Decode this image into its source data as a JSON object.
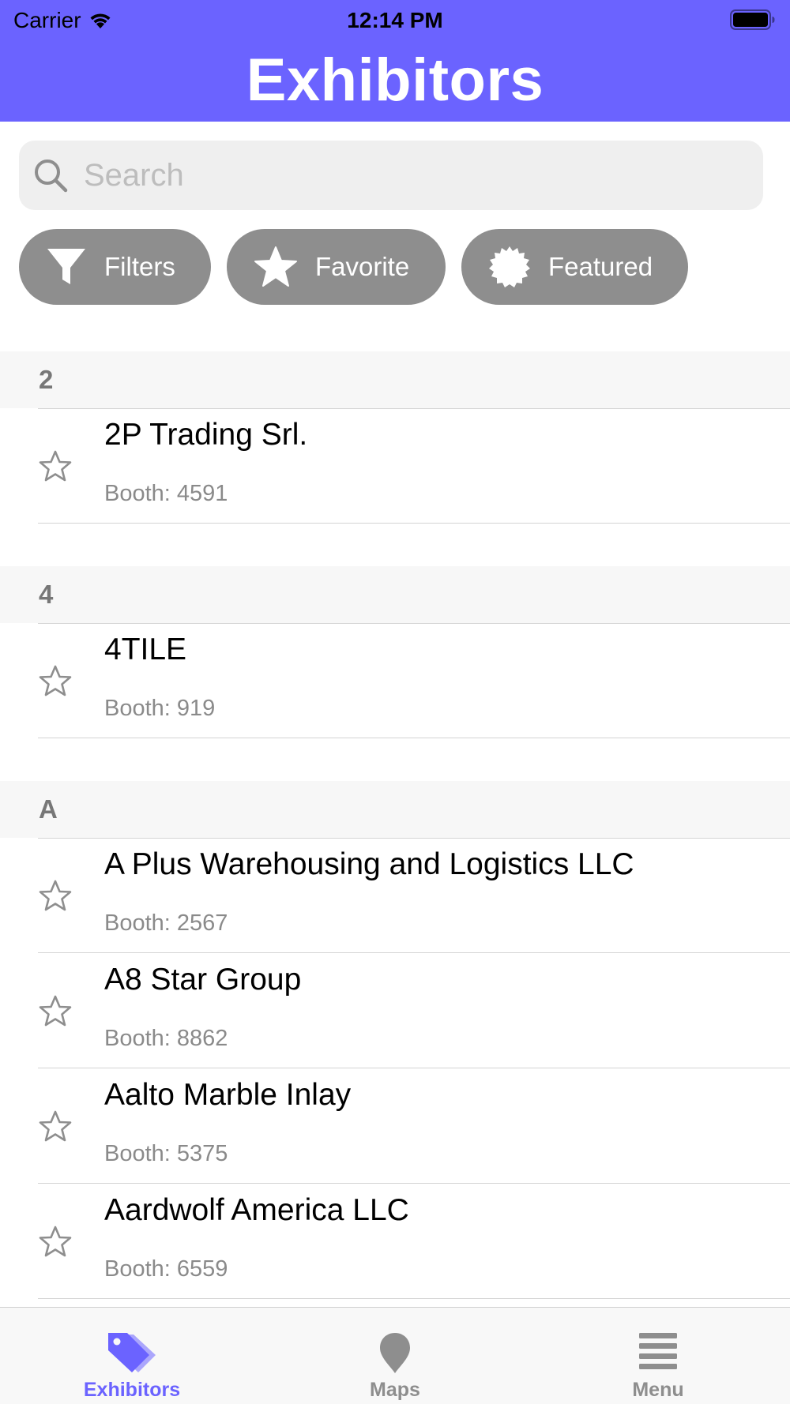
{
  "status_bar": {
    "carrier": "Carrier",
    "time": "12:14 PM"
  },
  "header": {
    "title": "Exhibitors",
    "color": "#6B63FF"
  },
  "search": {
    "placeholder": "Search",
    "value": ""
  },
  "chips": [
    {
      "label": "Filters",
      "icon": "funnel-icon"
    },
    {
      "label": "Favorite",
      "icon": "star-filled-icon"
    },
    {
      "label": "Featured",
      "icon": "seal-badge-icon"
    }
  ],
  "sections": [
    {
      "header": "2",
      "items": [
        {
          "name": "2P Trading Srl.",
          "booth": "Booth: 4591"
        }
      ]
    },
    {
      "header": "4",
      "items": [
        {
          "name": "4TILE",
          "booth": "Booth: 919"
        }
      ]
    },
    {
      "header": "A",
      "items": [
        {
          "name": "A Plus Warehousing and Logistics LLC",
          "booth": "Booth: 2567"
        },
        {
          "name": "A8 Star Group",
          "booth": "Booth: 8862"
        },
        {
          "name": "Aalto Marble Inlay",
          "booth": "Booth: 5375"
        },
        {
          "name": "Aardwolf America LLC",
          "booth": "Booth: 6559"
        }
      ]
    }
  ],
  "tabbar": {
    "tabs": [
      {
        "label": "Exhibitors",
        "icon": "tags-icon",
        "active": true
      },
      {
        "label": "Maps",
        "icon": "map-pin-icon",
        "active": false
      },
      {
        "label": "Menu",
        "icon": "hamburger-menu-icon",
        "active": false
      }
    ],
    "active_color": "#6B63FF",
    "inactive_color": "#8E8E8E"
  }
}
